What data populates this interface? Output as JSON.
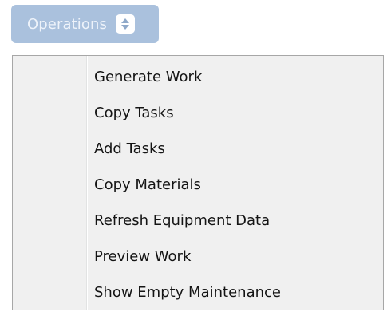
{
  "operations_button": {
    "label": "Operations",
    "icon": "up-down-arrows-icon",
    "color": "#aac1dd"
  },
  "menu": {
    "items": [
      {
        "label": "Generate Work"
      },
      {
        "label": "Copy Tasks"
      },
      {
        "label": "Add Tasks"
      },
      {
        "label": "Copy Materials"
      },
      {
        "label": "Refresh Equipment Data"
      },
      {
        "label": "Preview Work"
      },
      {
        "label": "Show Empty Maintenance"
      }
    ]
  }
}
